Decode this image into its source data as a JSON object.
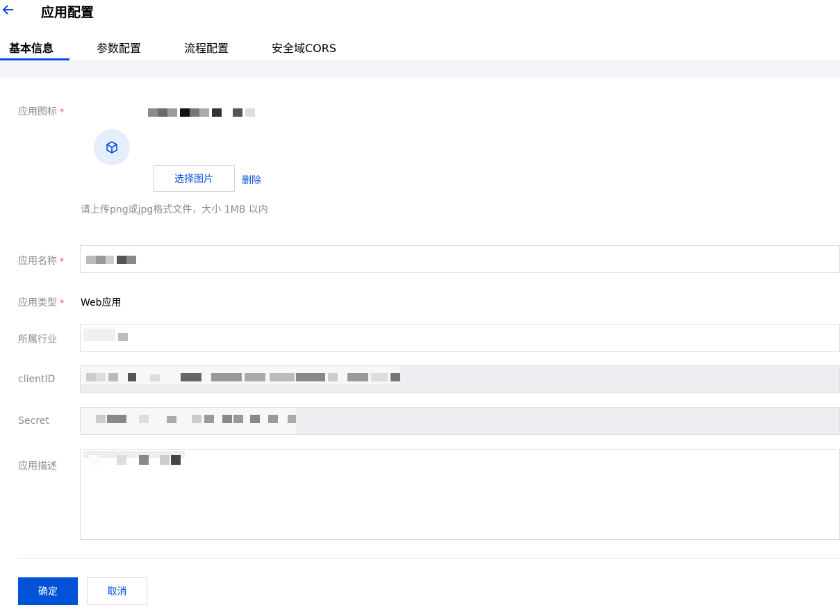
{
  "header": {
    "title": "应用配置",
    "back_icon": "arrow-left-icon"
  },
  "tabs": [
    {
      "label": "基本信息",
      "active": true
    },
    {
      "label": "参数配置",
      "active": false
    },
    {
      "label": "流程配置",
      "active": false
    },
    {
      "label": "安全域CORS",
      "active": false
    }
  ],
  "form": {
    "icon_label": "应用图标",
    "required_mark": "*",
    "app_icon": "cube-icon",
    "select_image_label": "选择图片",
    "delete_label": "删除",
    "upload_hint": "请上传png或jpg格式文件，大小 1MB 以内",
    "name_label": "应用名称",
    "type_label": "应用类型",
    "type_value": "Web应用",
    "industry_label": "所属行业",
    "client_id_label": "clientID",
    "secret_label": "Secret",
    "description_label": "应用描述"
  },
  "footer": {
    "confirm_label": "确定",
    "cancel_label": "取消"
  },
  "colors": {
    "accent": "#0052d9",
    "required": "#e34d59",
    "disabled_bg": "#eceef2"
  }
}
